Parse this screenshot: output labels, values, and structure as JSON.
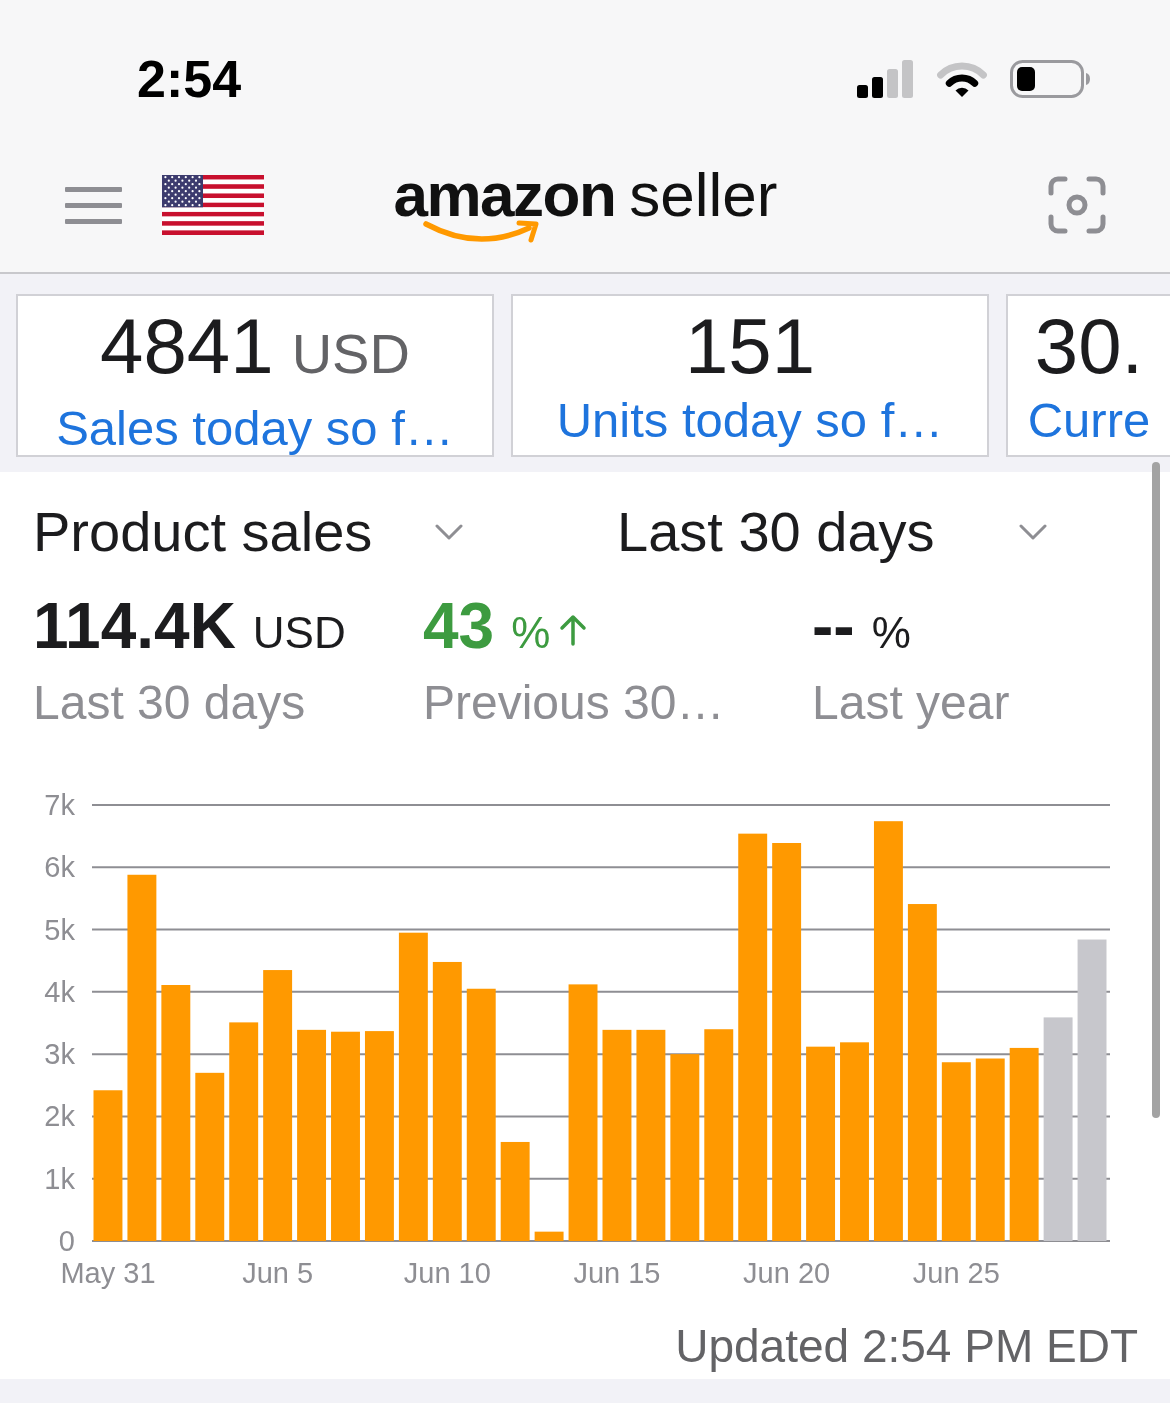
{
  "status_bar": {
    "time": "2:54"
  },
  "nav": {
    "logo": {
      "brand": "amazon",
      "product": "seller"
    }
  },
  "summary_cards": [
    {
      "value": "4841",
      "unit": "USD",
      "label": "Sales today so f…"
    },
    {
      "value": "151",
      "label": "Units today so f…"
    },
    {
      "value": "30.",
      "label": "Curre"
    }
  ],
  "metric_selector": {
    "label": "Product sales"
  },
  "period_selector": {
    "label": "Last 30 days"
  },
  "metrics": [
    {
      "value": "114.4K",
      "unit": "USD",
      "label": "Last 30 days",
      "increase": false
    },
    {
      "value": "43",
      "unit": "%",
      "label": "Previous 30…",
      "increase": true
    },
    {
      "value": "--",
      "unit": "%",
      "label": "Last year",
      "increase": false
    }
  ],
  "chart": {
    "chart_data": {
      "type": "bar",
      "categories": [
        "May 31",
        null,
        null,
        null,
        null,
        "Jun 5",
        null,
        null,
        null,
        null,
        "Jun 10",
        null,
        null,
        null,
        null,
        "Jun 15",
        null,
        null,
        null,
        null,
        "Jun 20",
        null,
        null,
        null,
        null,
        "Jun 25",
        null,
        null,
        null,
        null
      ],
      "series": [
        {
          "color": "#ff9900",
          "values": [
            2420,
            5880,
            4110,
            2700,
            3510,
            4350,
            3390,
            3360,
            3370,
            4950,
            4480,
            4050,
            1590,
            150,
            4120,
            3390,
            3390,
            3000,
            3400,
            6540,
            6390,
            3120,
            3190,
            6740,
            5410,
            2870,
            2930,
            3100,
            null,
            null
          ]
        },
        {
          "color": "#c7c7cc",
          "values": [
            null,
            null,
            null,
            null,
            null,
            null,
            null,
            null,
            null,
            null,
            null,
            null,
            null,
            null,
            null,
            null,
            null,
            null,
            null,
            null,
            null,
            null,
            null,
            null,
            null,
            null,
            null,
            null,
            3590,
            4840
          ]
        }
      ],
      "ylim": [
        0,
        7000
      ],
      "yticks": [
        {
          "value": 0,
          "label": "0"
        },
        {
          "value": 1000,
          "label": "1k"
        },
        {
          "value": 2000,
          "label": "2k"
        },
        {
          "value": 3000,
          "label": "3k"
        },
        {
          "value": 4000,
          "label": "4k"
        },
        {
          "value": 5000,
          "label": "5k"
        },
        {
          "value": 6000,
          "label": "6k"
        },
        {
          "value": 7000,
          "label": "7k"
        }
      ],
      "grid": true
    }
  },
  "updated": "Updated 2:54 PM EDT"
}
